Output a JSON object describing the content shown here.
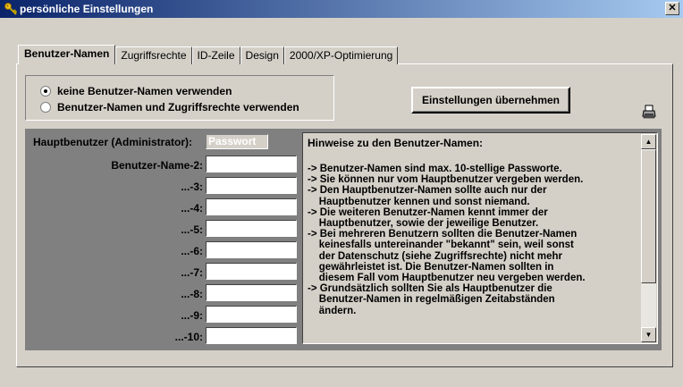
{
  "window": {
    "title": "persönliche Einstellungen",
    "close_label": "✕"
  },
  "tabs": [
    {
      "label": "Benutzer-Namen",
      "active": true
    },
    {
      "label": "Zugriffsrechte",
      "active": false
    },
    {
      "label": "ID-Zeile",
      "active": false
    },
    {
      "label": "Design",
      "active": false
    },
    {
      "label": "2000/XP-Optimierung",
      "active": false
    }
  ],
  "options": {
    "no_names": {
      "label": "keine Benutzer-Namen verwenden",
      "checked": true
    },
    "use_names": {
      "label": "Benutzer-Namen und Zugriffsrechte verwenden",
      "checked": false
    }
  },
  "apply_button": "Einstellungen übernehmen",
  "admin": {
    "label": "Hauptbenutzer (Administrator):",
    "password_placeholder": "Passwort"
  },
  "users": [
    {
      "label": "Benutzer-Name-2:",
      "value": ""
    },
    {
      "label": "...-3:",
      "value": ""
    },
    {
      "label": "...-4:",
      "value": ""
    },
    {
      "label": "...-5:",
      "value": ""
    },
    {
      "label": "...-6:",
      "value": ""
    },
    {
      "label": "...-7:",
      "value": ""
    },
    {
      "label": "...-8:",
      "value": ""
    },
    {
      "label": "...-9:",
      "value": ""
    },
    {
      "label": "...-10:",
      "value": ""
    }
  ],
  "hints": {
    "title": "Hinweise zu den Benutzer-Namen:",
    "body": "-> Benutzer-Namen sind max. 10-stellige Passworte.\n-> Sie können nur vom Hauptbenutzer vergeben werden.\n-> Den Hauptbenutzer-Namen sollte auch nur der\n    Hauptbenutzer kennen und sonst niemand.\n-> Die weiteren Benutzer-Namen kennt immer der\n    Hauptbenutzer, sowie der jeweilige Benutzer.\n-> Bei mehreren Benutzern sollten die Benutzer-Namen\n    keinesfalls untereinander \"bekannt\" sein, weil sonst\n    der Datenschutz (siehe Zugriffsrechte) nicht mehr\n    gewährleistet ist. Die Benutzer-Namen sollten in\n    diesem Fall vom Hauptbenutzer neu vergeben werden.\n-> Grundsätzlich sollten Sie als Hauptbenutzer die\n    Benutzer-Namen in regelmäßigen Zeitabständen\n    ändern."
  },
  "icons": {
    "title": "key-icon",
    "print": "printer-icon"
  },
  "colors": {
    "titlebar_start": "#0a246a",
    "titlebar_end": "#a6caf0",
    "panel_gray": "#808080"
  }
}
